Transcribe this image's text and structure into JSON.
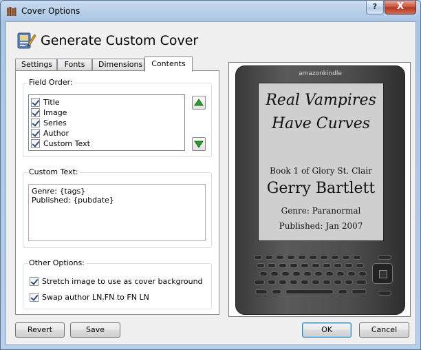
{
  "window": {
    "title": "Cover Options",
    "help_label": "?",
    "close_label": "X"
  },
  "header": {
    "title": "Generate Custom Cover"
  },
  "tabs": [
    {
      "label": "Settings"
    },
    {
      "label": "Fonts"
    },
    {
      "label": "Dimensions"
    },
    {
      "label": "Contents",
      "active": true
    }
  ],
  "field_order": {
    "label": "Field Order:",
    "items": [
      {
        "label": "Title",
        "checked": true
      },
      {
        "label": "Image",
        "checked": true
      },
      {
        "label": "Series",
        "checked": true
      },
      {
        "label": "Author",
        "checked": true
      },
      {
        "label": "Custom Text",
        "checked": true
      }
    ]
  },
  "custom_text": {
    "label": "Custom Text:",
    "line1": "Genre: {tags}",
    "line2": "Published: {pubdate}"
  },
  "other_options": {
    "label": "Other Options:",
    "stretch_label": "Stretch image to use as cover background",
    "stretch_checked": true,
    "swap_label": "Swap author LN,FN to FN LN",
    "swap_checked": true
  },
  "preview": {
    "brand": "amazonkindle",
    "title_line1": "Real Vampires",
    "title_line2": "Have Curves",
    "series": "Book 1 of Glory St. Clair",
    "author": "Gerry Bartlett",
    "genre": "Genre: Paranormal",
    "published": "Published: Jan 2007"
  },
  "buttons": {
    "revert": "Revert",
    "save": "Save",
    "ok": "OK",
    "cancel": "Cancel"
  },
  "colors": {
    "arrow_green": "#2e9a2e",
    "titlebar": "#b9d1ea",
    "close_red": "#c7503c"
  }
}
